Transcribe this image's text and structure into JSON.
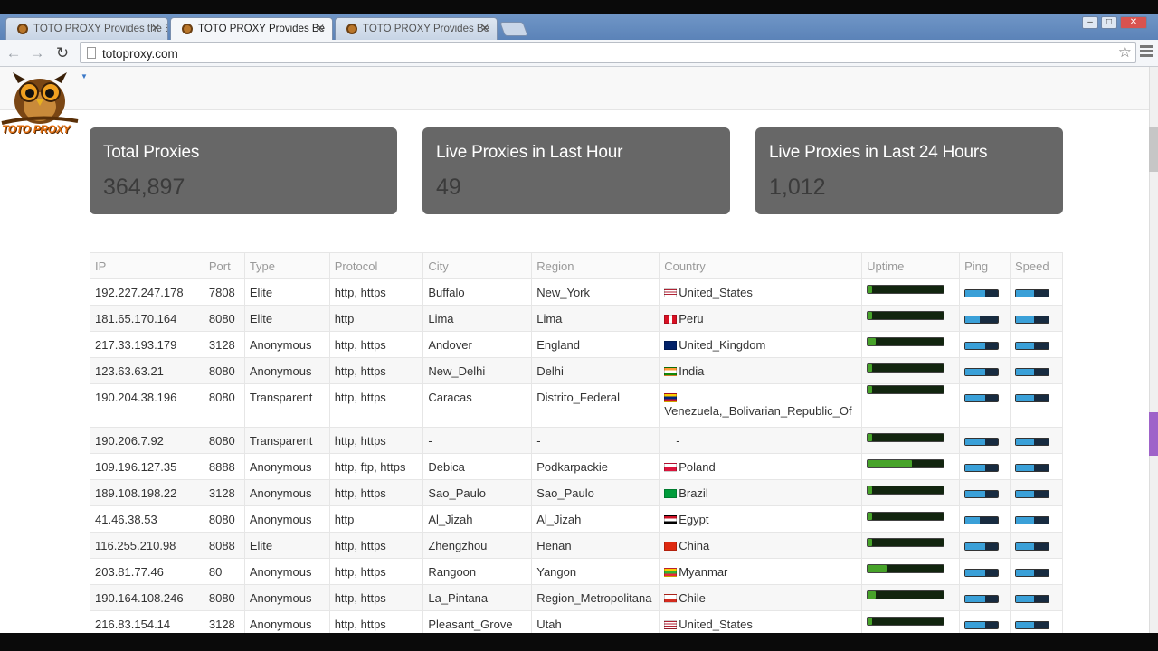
{
  "browser": {
    "tabs": [
      {
        "title": "TOTO PROXY Provides the Best V",
        "active": false
      },
      {
        "title": "TOTO PROXY Provides Be",
        "active": true
      },
      {
        "title": "TOTO PROXY Provides Be",
        "active": false
      }
    ],
    "url": "totoproxy.com"
  },
  "site": {
    "logo_text": "TOTO PROXY"
  },
  "stats": [
    {
      "title": "Total Proxies",
      "value": "364,897"
    },
    {
      "title": "Live Proxies in Last Hour",
      "value": "49"
    },
    {
      "title": "Live Proxies in Last 24 Hours",
      "value": "1,012"
    }
  ],
  "table": {
    "headers": [
      "IP",
      "Port",
      "Type",
      "Protocol",
      "City",
      "Region",
      "Country",
      "Uptime",
      "Ping",
      "Speed"
    ],
    "rows": [
      {
        "ip": "192.227.247.178",
        "port": "7808",
        "type": "Elite",
        "protocol": "http, https",
        "city": "Buffalo",
        "region": "New_York",
        "country": "United_States",
        "flag": "us",
        "uptime": 0.01,
        "ping": 0.6,
        "speed": 0.55
      },
      {
        "ip": "181.65.170.164",
        "port": "8080",
        "type": "Elite",
        "protocol": "http",
        "city": "Lima",
        "region": "Lima",
        "country": "Peru",
        "flag": "pe",
        "uptime": 0.01,
        "ping": 0.45,
        "speed": 0.55
      },
      {
        "ip": "217.33.193.179",
        "port": "3128",
        "type": "Anonymous",
        "protocol": "http, https",
        "city": "Andover",
        "region": "England",
        "country": "United_Kingdom",
        "flag": "gb",
        "uptime": 0.1,
        "ping": 0.6,
        "speed": 0.55
      },
      {
        "ip": "123.63.63.21",
        "port": "8080",
        "type": "Anonymous",
        "protocol": "http, https",
        "city": "New_Delhi",
        "region": "Delhi",
        "country": "India",
        "flag": "in",
        "uptime": 0.01,
        "ping": 0.6,
        "speed": 0.55
      },
      {
        "ip": "190.204.38.196",
        "port": "8080",
        "type": "Transparent",
        "protocol": "http, https",
        "city": "Caracas",
        "region": "Distrito_Federal",
        "country": "Venezuela,_Bolivarian_Republic_Of",
        "flag": "ve",
        "uptime": 0.01,
        "ping": 0.6,
        "speed": 0.55
      },
      {
        "ip": "190.206.7.92",
        "port": "8080",
        "type": "Transparent",
        "protocol": "http, https",
        "city": "-",
        "region": "-",
        "country": "-",
        "flag": "",
        "uptime": 0.01,
        "ping": 0.6,
        "speed": 0.55
      },
      {
        "ip": "109.196.127.35",
        "port": "8888",
        "type": "Anonymous",
        "protocol": "http, ftp, https",
        "city": "Debica",
        "region": "Podkarpackie",
        "country": "Poland",
        "flag": "pl",
        "uptime": 0.58,
        "ping": 0.6,
        "speed": 0.55
      },
      {
        "ip": "189.108.198.22",
        "port": "3128",
        "type": "Anonymous",
        "protocol": "http, https",
        "city": "Sao_Paulo",
        "region": "Sao_Paulo",
        "country": "Brazil",
        "flag": "br",
        "uptime": 0.01,
        "ping": 0.6,
        "speed": 0.55
      },
      {
        "ip": "41.46.38.53",
        "port": "8080",
        "type": "Anonymous",
        "protocol": "http",
        "city": "Al_Jizah",
        "region": "Al_Jizah",
        "country": "Egypt",
        "flag": "eg",
        "uptime": 0.01,
        "ping": 0.45,
        "speed": 0.55
      },
      {
        "ip": "116.255.210.98",
        "port": "8088",
        "type": "Elite",
        "protocol": "http, https",
        "city": "Zhengzhou",
        "region": "Henan",
        "country": "China",
        "flag": "cn",
        "uptime": 0.01,
        "ping": 0.6,
        "speed": 0.55
      },
      {
        "ip": "203.81.77.46",
        "port": "80",
        "type": "Anonymous",
        "protocol": "http, https",
        "city": "Rangoon",
        "region": "Yangon",
        "country": "Myanmar",
        "flag": "mm",
        "uptime": 0.25,
        "ping": 0.6,
        "speed": 0.55
      },
      {
        "ip": "190.164.108.246",
        "port": "8080",
        "type": "Anonymous",
        "protocol": "http, https",
        "city": "La_Pintana",
        "region": "Region_Metropolitana",
        "country": "Chile",
        "flag": "cl",
        "uptime": 0.1,
        "ping": 0.6,
        "speed": 0.55
      },
      {
        "ip": "216.83.154.14",
        "port": "3128",
        "type": "Anonymous",
        "protocol": "http, https",
        "city": "Pleasant_Grove",
        "region": "Utah",
        "country": "United_States",
        "flag": "us",
        "uptime": 0.01,
        "ping": 0.6,
        "speed": 0.55
      }
    ]
  },
  "colors": {
    "stat_box": "#676767",
    "uptime_fill": "#47a32a",
    "bar_fill": "#3aa0d8",
    "logo": "#e36d0c"
  }
}
